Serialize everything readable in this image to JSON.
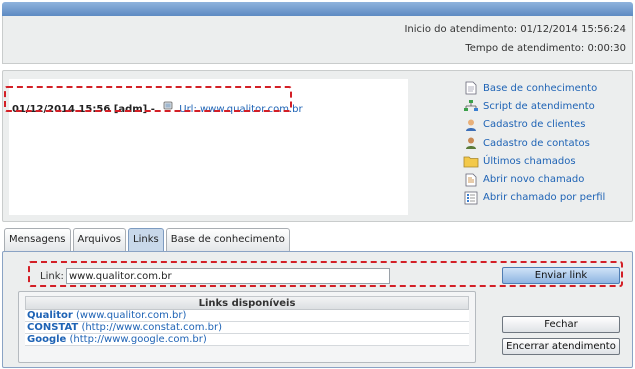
{
  "header": {
    "inicio_label": "Inicio do atendimento:",
    "inicio_value": "01/12/2014 15:56:24",
    "tempo_label": "Tempo de atendimento:",
    "tempo_value": "0:00:30"
  },
  "chat": {
    "message_head": "01/12/2014 15:56 [adm] -",
    "message_link": "Url: www.qualitor.com.br"
  },
  "menu": [
    {
      "label": "Base de conhecimento",
      "icon": "document-icon"
    },
    {
      "label": "Script de atendimento",
      "icon": "flowchart-icon"
    },
    {
      "label": "Cadastro de clientes",
      "icon": "user-icon"
    },
    {
      "label": "Cadastro de contatos",
      "icon": "contacts-icon"
    },
    {
      "label": "Últimos chamados",
      "icon": "folder-icon"
    },
    {
      "label": "Abrir novo chamado",
      "icon": "new-document-icon"
    },
    {
      "label": "Abrir chamado por perfil",
      "icon": "list-icon"
    }
  ],
  "tabs": [
    "Mensagens",
    "Arquivos",
    "Links",
    "Base de conhecimento"
  ],
  "active_tab": "Links",
  "link_form": {
    "label": "Link:",
    "value": "www.qualitor.com.br",
    "send_button": "Enviar link"
  },
  "links_box": {
    "title": "Links disponíveis",
    "rows": [
      {
        "name": "Qualitor",
        "url": "(www.qualitor.com.br)"
      },
      {
        "name": "CONSTAT",
        "url": "(http://www.constat.com.br)"
      },
      {
        "name": "Google",
        "url": "(http://www.google.com.br)"
      }
    ]
  },
  "buttons": {
    "close": "Fechar",
    "end": "Encerrar atendimento"
  },
  "colors": {
    "link": "#1e63b5",
    "highlight": "#d31f26",
    "panel": "#eceeee"
  }
}
